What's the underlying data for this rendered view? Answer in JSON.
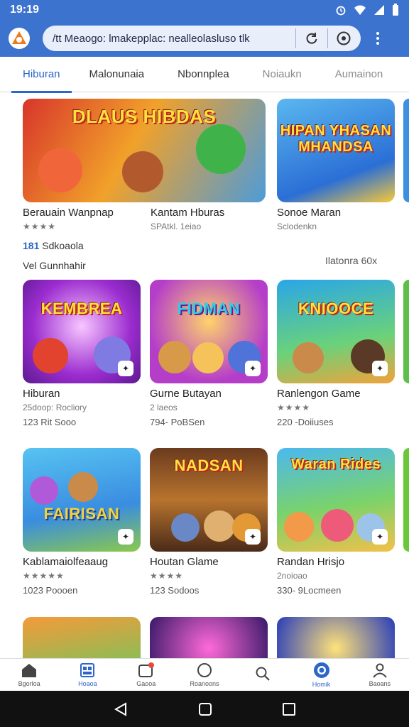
{
  "status_bar": {
    "time": "19:19"
  },
  "browser": {
    "url": "/tt  Meaogo: lmakepplac: nealleolasluso tlk"
  },
  "tabs": [
    {
      "label": "Hiburan"
    },
    {
      "label": "Malonunaia"
    },
    {
      "label": "Nbonnplea"
    },
    {
      "label": "Noiaukn"
    },
    {
      "label": "Aumainon"
    }
  ],
  "colors": {
    "accent": "#2d65c8",
    "header": "#3b73cf",
    "star": "#f2b400"
  },
  "cards": [
    {
      "art": "DLAUS HIBDAS",
      "title": "Berauain Wanpnap",
      "sub": "★★★★"
    },
    {
      "art": "",
      "title": "Kantam Hburas",
      "sub": "SPAtkl. 1eiao"
    },
    {
      "art": "HIPAN YHASAN MHANDSA",
      "title": "Sonoe Maran",
      "sub": "Sclodenkn"
    },
    {
      "art": "KEMBREA",
      "title": "Hiburan",
      "sub": "25doop: Rocliory",
      "meta": "123 Rit Sooo"
    },
    {
      "art": "FIDMAN",
      "title": "Gurne Butayan",
      "sub": "2 laeos",
      "meta": "794- PoBSen"
    },
    {
      "art": "KNIOOCE",
      "title": "Ranlengon Game",
      "sub": "★★★★",
      "meta": "220 -Doiiuses"
    },
    {
      "art": "FAIRISAN",
      "title": "Kablamaiolfeaaug",
      "sub": "★★★★★",
      "meta": "1023 Poooen"
    },
    {
      "art": "NADSAN",
      "title": "Houtan Glame",
      "sub": "★★★★",
      "meta": "123 Sodoos"
    },
    {
      "art": "Waran Rides",
      "title": "Randan Hrisjo",
      "sub": "2noioao",
      "meta": "330- 9Locmeen"
    }
  ],
  "row1_extras": {
    "count": "181",
    "count_label": "Sdkoaola",
    "left_note": "Vel Gunnhahir",
    "right_note": "Ilatonra 60x"
  },
  "bottom_nav": [
    {
      "label": "Bgorloa",
      "icon": "home-icon"
    },
    {
      "label": "Hoaoa",
      "icon": "apps-icon"
    },
    {
      "label": "Gaooa",
      "icon": "games-icon"
    },
    {
      "label": "Roanoons",
      "icon": "circle-icon"
    },
    {
      "label": "",
      "icon": "search-icon"
    },
    {
      "label": "Homik",
      "icon": "target-icon"
    },
    {
      "label": "Baoans",
      "icon": "profile-icon"
    }
  ]
}
